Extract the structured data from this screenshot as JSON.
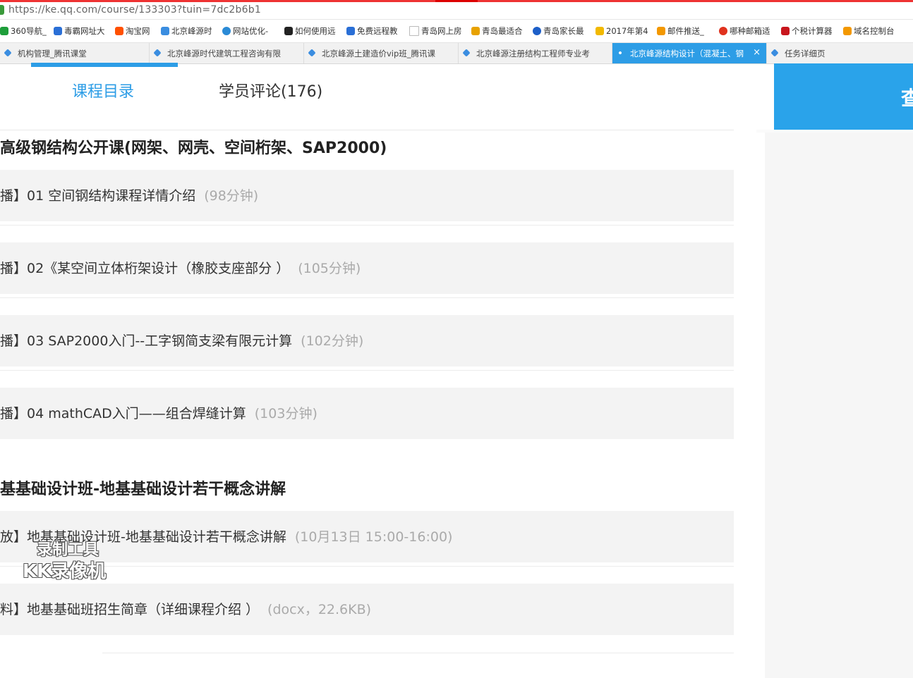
{
  "address_bar": {
    "url": "https://ke.qq.com/course/133303?tuin=7dc2b6b1"
  },
  "bookmarks": [
    {
      "label": "360导航_",
      "icon": "360-icon",
      "color": "#1e9e3a"
    },
    {
      "label": "毒霸网址大",
      "icon": "duba-icon",
      "color": "#2a6fd6"
    },
    {
      "label": "淘宝网",
      "icon": "taobao-icon",
      "color": "#ff5000"
    },
    {
      "label": "北京峰源时",
      "icon": "tencent-class-icon",
      "color": "#3a8de0"
    },
    {
      "label": "网站优化-",
      "icon": "seo-icon",
      "color": "#2a8ad6"
    },
    {
      "label": "如何使用远",
      "icon": "baidu-knows-icon",
      "color": "#222222"
    },
    {
      "label": "免费远程教",
      "icon": "teamviewer-icon",
      "color": "#2a6fd6"
    },
    {
      "label": "青岛网上房",
      "icon": "page-icon",
      "color": "#bbbbbb"
    },
    {
      "label": "青岛最适合",
      "icon": "sogou-icon",
      "color": "#e8a200"
    },
    {
      "label": "青岛家长最",
      "icon": "search-q-icon",
      "color": "#1d5fc8"
    },
    {
      "label": "2017年第4",
      "icon": "trophy-icon",
      "color": "#f2b900"
    },
    {
      "label": "邮件推送_",
      "icon": "mail-push-icon",
      "color": "#f39800"
    },
    {
      "label": "哪种邮箱适",
      "icon": "bird-icon",
      "color": "#e0321e"
    },
    {
      "label": "个税计算器",
      "icon": "tax-icon",
      "color": "#c8161d"
    },
    {
      "label": "域名控制台",
      "icon": "console-icon",
      "color": "#f39800"
    }
  ],
  "tabs": [
    {
      "label": "机构管理_腾讯课堂",
      "active": false
    },
    {
      "label": "北京峰源时代建筑工程咨询有限",
      "active": false
    },
    {
      "label": "北京峰源土建造价vip班_腾讯课",
      "active": false
    },
    {
      "label": "北京峰源注册结构工程师专业考",
      "active": false
    },
    {
      "label": "北京峰源结构设计（混凝土、钢",
      "active": true
    },
    {
      "label": "任务详细页",
      "active": false
    }
  ],
  "course_nav": {
    "catalog": "课程目录",
    "reviews": "学员评论(176)"
  },
  "sections": [
    {
      "title": "高级钢结构公开课(网架、网壳、空间桁架、SAP2000)",
      "lessons": [
        {
          "text": "播】01 空间钢结构课程详情介绍",
          "meta": "(98分钟)"
        },
        {
          "text": "播】02《某空间立体桁架设计（橡胶支座部分 ）",
          "meta": "(105分钟)"
        },
        {
          "text": "播】03 SAP2000入门--工字钢简支梁有限元计算",
          "meta": "(102分钟)"
        },
        {
          "text": "播】04 mathCAD入门——组合焊缝计算",
          "meta": "(103分钟)"
        }
      ]
    },
    {
      "title": "基基础设计班-地基基础设计若干概念讲解",
      "lessons": [
        {
          "text": "放】地基基础设计班-地基基础设计若干概念讲解",
          "meta": "(10月13日 15:00-16:00)"
        },
        {
          "text": "料】地基基础班招生简章（详细课程介绍 ）",
          "meta": "(docx，22.6KB)"
        }
      ]
    }
  ],
  "sidebar": {
    "button_label": "查"
  },
  "watermark": {
    "line1": "录制工具",
    "line2": "KK录像机"
  },
  "colors": {
    "accent": "#2d9de6",
    "meta_text": "#aaaaaa",
    "row_bg": "#f3f3f3"
  }
}
